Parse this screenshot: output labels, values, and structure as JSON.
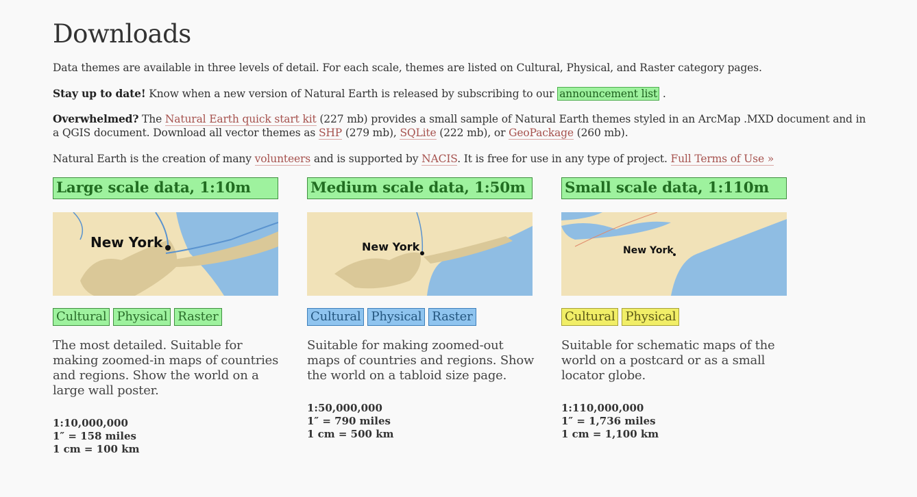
{
  "page_title": "Downloads",
  "intro": "Data themes are available in three levels of detail. For each scale, themes are listed on Cultural, Physical, and Raster category pages.",
  "stay": {
    "bold": "Stay up to date!",
    "text": " Know when a new version of Natural Earth is released by subscribing to our ",
    "link": "announcement list",
    "end": " ."
  },
  "overwhelmed": {
    "bold": "Overwhelmed?",
    "t1": " The ",
    "kit_link": "Natural Earth quick start kit",
    "t2": " (227 mb) provides a small sample of Natural Earth themes styled in an ArcMap .MXD document and in a QGIS document. Download all vector themes as ",
    "shp_link": "SHP",
    "t3": " (279 mb), ",
    "sqlite_link": "SQLite",
    "t4": " (222 mb), or ",
    "gpkg_link": "GeoPackage",
    "t5": " (260 mb)."
  },
  "credits": {
    "t1": "Natural Earth is the creation of many ",
    "volunteers_link": "volunteers",
    "t2": " and is supported by ",
    "nacis_link": "NACIS",
    "t3": ". It is free for use in any type of project. ",
    "terms_link": "Full Terms of Use »"
  },
  "colors": {
    "link": "#a6524e",
    "green_bg": "#9ef29e",
    "blue_bg": "#8fc4ef",
    "yellow_bg": "#f1ee67",
    "land": "#f1e2b8",
    "urban": "#dac898",
    "water": "#8fbde3"
  },
  "columns": [
    {
      "title": "Large scale data, 1:10m",
      "map_label": "New York",
      "tags": [
        "Cultural",
        "Physical",
        "Raster"
      ],
      "tag_color": "green",
      "description": "The most detailed. Suitable for making zoomed-in maps of countries and regions. Show the world on a large wall poster.",
      "scale_lines": [
        "1:10,000,000",
        "1″ = 158 miles",
        "1 cm = 100 km"
      ]
    },
    {
      "title": "Medium scale data, 1:50m",
      "map_label": "New York",
      "tags": [
        "Cultural",
        "Physical",
        "Raster"
      ],
      "tag_color": "blue",
      "description": "Suitable for making zoomed-out maps of countries and regions. Show the world on a tabloid size page.",
      "scale_lines": [
        "1:50,000,000",
        "1″ = 790 miles",
        "1 cm = 500 km"
      ]
    },
    {
      "title": "Small scale data, 1:110m",
      "map_label": "New York",
      "tags": [
        "Cultural",
        "Physical"
      ],
      "tag_color": "yellow",
      "description": "Suitable for schematic maps of the world on a postcard or as a small locator globe.",
      "scale_lines": [
        "1:110,000,000",
        "1″ = 1,736 miles",
        "1 cm = 1,100 km"
      ]
    }
  ]
}
